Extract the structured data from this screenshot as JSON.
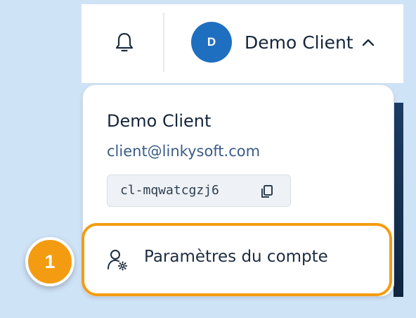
{
  "header": {
    "avatar_initial": "D",
    "user_name": "Demo Client",
    "icons": [
      "bell-icon",
      "chevron-up-icon"
    ]
  },
  "dropdown": {
    "name": "Demo Client",
    "email": "client@linkysoft.com",
    "client_id": "cl-mqwatcgzj6",
    "copy_icon": "copy-icon",
    "menu_items": [
      {
        "label": "Paramètres du compte",
        "icon": "user-settings-icon"
      }
    ]
  },
  "annotation": {
    "step_number": "1"
  },
  "colors": {
    "avatar": "#1f6fc1",
    "highlight": "#f39c12",
    "background": "#cfe3f7",
    "email_text": "#3a5c86"
  }
}
